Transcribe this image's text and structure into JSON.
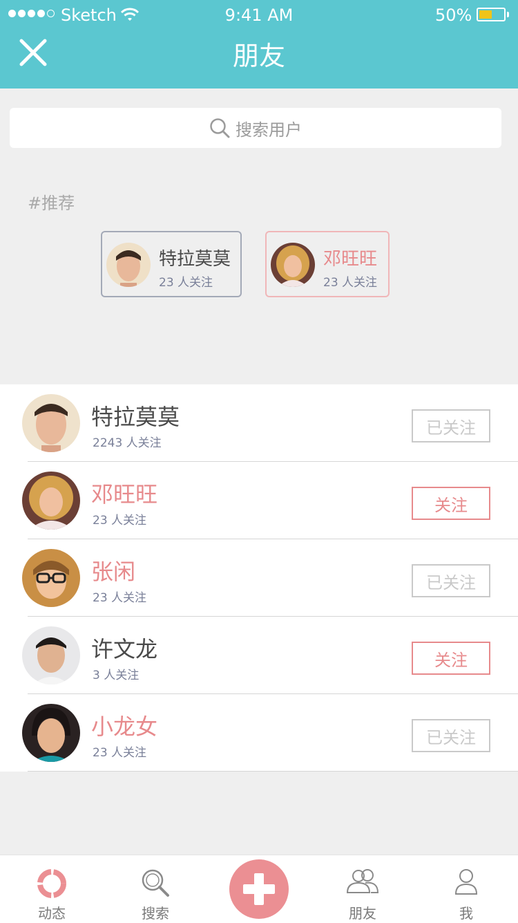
{
  "status": {
    "carrier": "Sketch",
    "time": "9:41 AM",
    "battery": "50%"
  },
  "header": {
    "title": "朋友"
  },
  "search": {
    "placeholder": "搜索用户"
  },
  "recommend": {
    "label": "#推荐",
    "cards": [
      {
        "name": "特拉莫莫",
        "followers": "23 人关注",
        "name_color": "#4a4a4a"
      },
      {
        "name": "邓旺旺",
        "followers": "23 人关注",
        "name_color": "#e78a8c"
      }
    ]
  },
  "users": [
    {
      "name": "特拉莫莫",
      "followers": "2243 人关注",
      "button": "已关注",
      "state": "followed",
      "name_color": "#4a4a4a"
    },
    {
      "name": "邓旺旺",
      "followers": "23 人关注",
      "button": "关注",
      "state": "follow",
      "name_color": "#e78a8c"
    },
    {
      "name": "张闲",
      "followers": "23 人关注",
      "button": "已关注",
      "state": "followed",
      "name_color": "#e78a8c"
    },
    {
      "name": "许文龙",
      "followers": "3 人关注",
      "button": "关注",
      "state": "follow",
      "name_color": "#4a4a4a"
    },
    {
      "name": "小龙女",
      "followers": "23 人关注",
      "button": "已关注",
      "state": "followed",
      "name_color": "#e78a8c"
    }
  ],
  "tabs": [
    {
      "label": "动态",
      "icon": "feed-ring-icon"
    },
    {
      "label": "搜索",
      "icon": "search-icon"
    },
    {
      "label": "",
      "icon": "plus-icon"
    },
    {
      "label": "朋友",
      "icon": "friends-icon"
    },
    {
      "label": "我",
      "icon": "profile-icon"
    }
  ]
}
